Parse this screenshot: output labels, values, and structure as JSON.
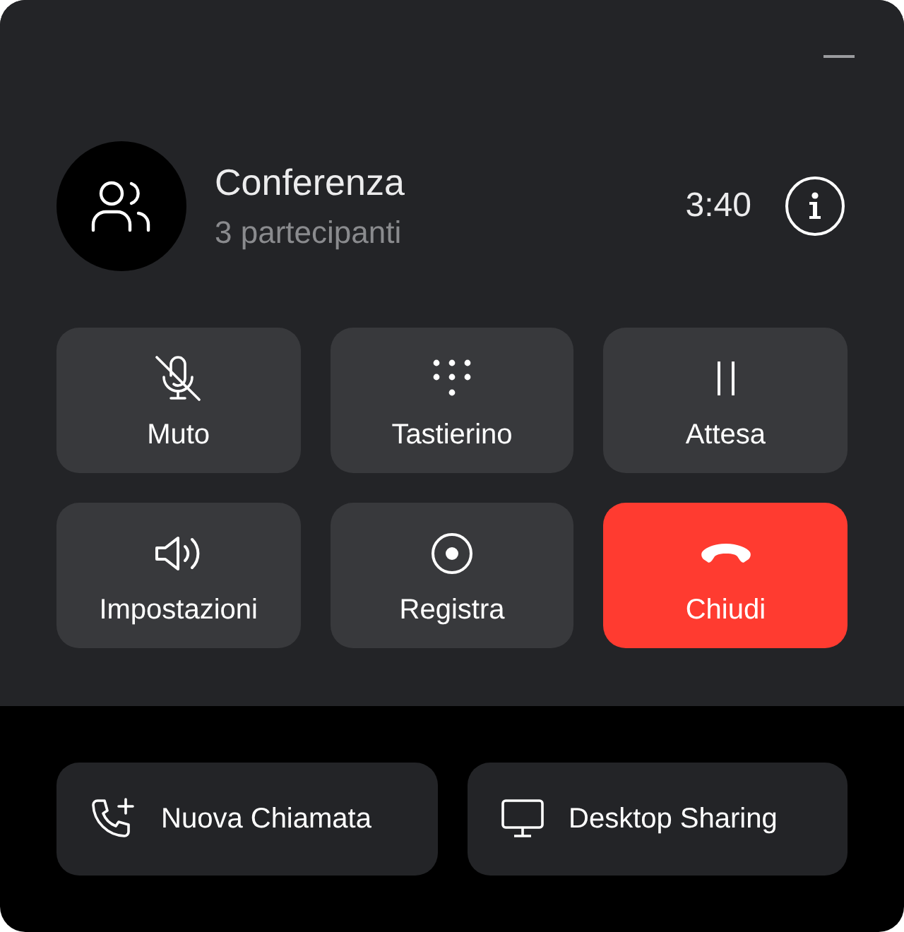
{
  "call": {
    "title": "Conferenza",
    "subtitle": "3 partecipanti",
    "duration": "3:40"
  },
  "controls": [
    {
      "label": "Muto",
      "kind": "normal"
    },
    {
      "label": "Tastierino",
      "kind": "normal"
    },
    {
      "label": "Attesa",
      "kind": "normal"
    },
    {
      "label": "Impostazioni",
      "kind": "normal"
    },
    {
      "label": "Registra",
      "kind": "normal"
    },
    {
      "label": "Chiudi",
      "kind": "danger"
    }
  ],
  "actions": [
    {
      "label": "Nuova Chiamata"
    },
    {
      "label": "Desktop Sharing"
    }
  ]
}
